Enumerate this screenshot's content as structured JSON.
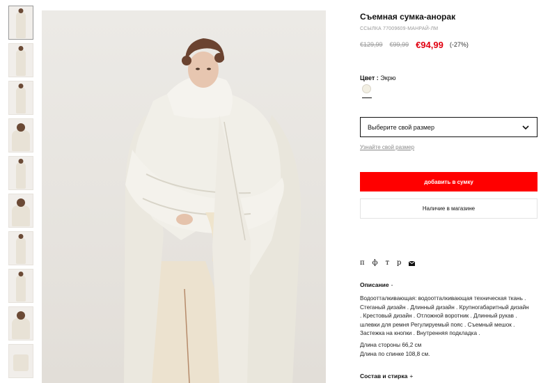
{
  "gallery": {
    "thumbnail_count": 10
  },
  "product": {
    "title": "Съемная сумка-анорак",
    "reference": "ССЫЛКА 77009609-МАНРАЙ-ЛМ",
    "price_original_1": "€129,99",
    "price_original_2": "€99,99",
    "price_current": "€94,99",
    "discount": "(-27%)",
    "color_prefix": "Цвет : ",
    "color_name": "Экрю",
    "color_hex": "#f2efe3"
  },
  "size": {
    "placeholder": "Выберите свой размер",
    "guide_link": "Узнайте свой размер"
  },
  "actions": {
    "add_to_bag": "добавить в сумку",
    "in_store": "Наличие в магазине"
  },
  "share": {
    "items": [
      "п",
      "ф",
      "т",
      "р"
    ],
    "mail_icon": "envelope-icon"
  },
  "description": {
    "heading": "Описание",
    "toggle": "-",
    "lines": [
      "Водоотталкивающая: водоотталкивающая техническая ткань .",
      "Стеганый дизайн . Длинный дизайн . Крупногабаритный дизайн",
      ". Крестовый дизайн . Отложной воротник . Длинный рукав .",
      "шлевки для ремня Регулируемый пояс . Съемный мешок .",
      "Застежка на кнопки . Внутренняя подкладка ."
    ],
    "measurements": [
      "Длина стороны 66,2 см",
      "Длина по спинке 108,8 см."
    ]
  },
  "composition": {
    "heading": "Состав и стирка",
    "toggle": "+"
  },
  "colors": {
    "sale_red": "#e10010",
    "button_red": "#ff0000"
  }
}
